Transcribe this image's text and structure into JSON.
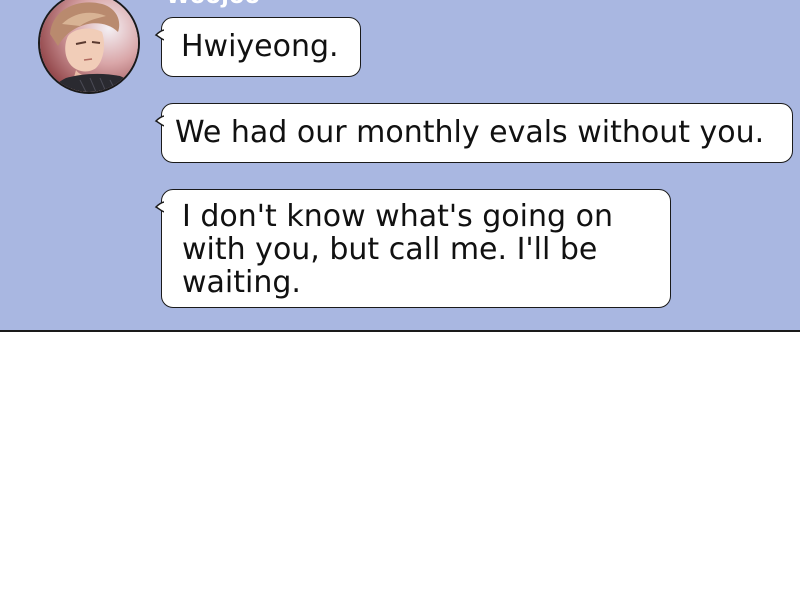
{
  "chat": {
    "sender_name": "Woojoo",
    "avatar_icon": "contact-avatar-portrait",
    "panel_color": "#a9b7e1",
    "messages": [
      {
        "text": "Hwiyeong."
      },
      {
        "text": "We had our monthly evals without you."
      },
      {
        "text": "I don't know what's going on with you, but call me. I'll be waiting."
      }
    ]
  }
}
